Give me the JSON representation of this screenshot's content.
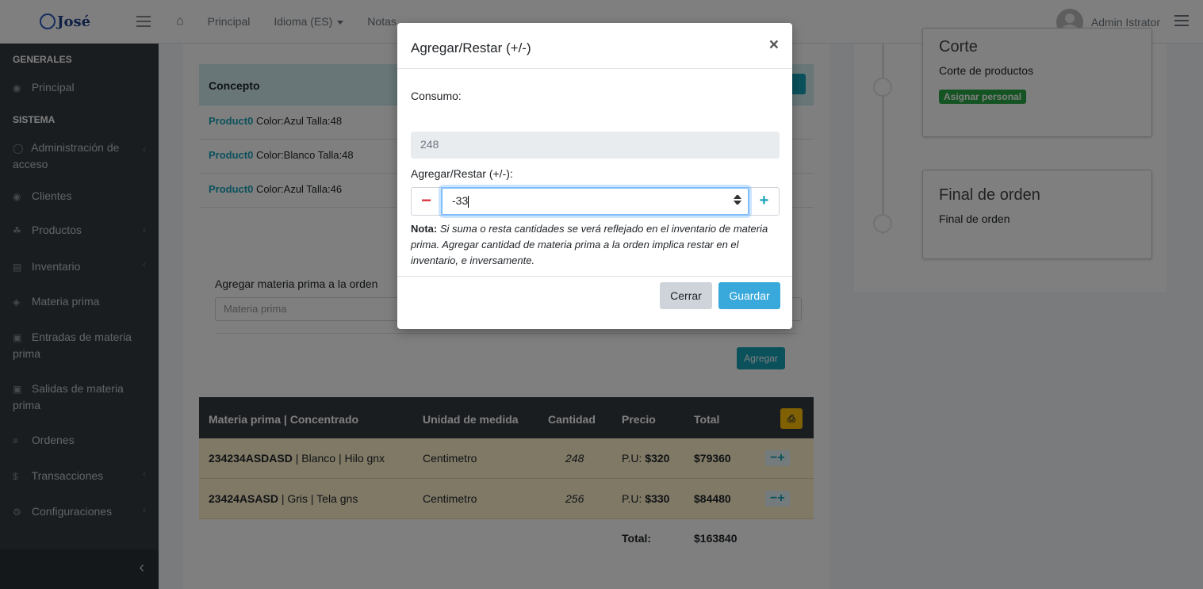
{
  "navbar": {
    "brand": "José",
    "links": [
      "Principal",
      "Idioma (ES)",
      "Notas"
    ],
    "user": "Admin Istrator"
  },
  "sidebar": {
    "headers": [
      "GENERALES",
      "SISTEMA"
    ],
    "items": [
      {
        "label": "Principal",
        "icon": "dashboard-icon"
      },
      {
        "label": "Administración de acceso",
        "icon": "user-icon"
      },
      {
        "label": "Clientes",
        "icon": "clients-icon"
      },
      {
        "label": "Productos",
        "icon": "products-icon"
      },
      {
        "label": "Inventario",
        "icon": "cart-icon"
      },
      {
        "label": "Materia prima",
        "icon": "box-icon"
      },
      {
        "label": "Entradas de materia prima",
        "icon": "plus-square-icon"
      },
      {
        "label": "Salidas de materia prima",
        "icon": "minus-square-icon"
      },
      {
        "label": "Ordenes",
        "icon": "list-icon"
      },
      {
        "label": "Transacciones",
        "icon": "dollar-icon"
      },
      {
        "label": "Configuraciones",
        "icon": "gears-icon"
      }
    ]
  },
  "content": {
    "concept_header": "Concepto",
    "products": [
      {
        "name": "Product0",
        "detail": "Color:Azul Talla:48"
      },
      {
        "name": "Product0",
        "detail": "Color:Blanco Talla:48"
      },
      {
        "name": "Product0",
        "detail": "Color:Azul Talla:46"
      }
    ],
    "add_label": "Agregar materia prima a la orden",
    "add_placeholder": "Materia prima",
    "add_button": "Agregar",
    "table": {
      "headers": [
        "Materia prima | Concentrado",
        "Unidad de medida",
        "Cantidad",
        "Precio",
        "Total"
      ],
      "rows": [
        {
          "code": "234234ASDASD",
          "rest": " | Blanco | Hilo gnx",
          "unit": "Centimetro",
          "qty": "248",
          "price_prefix": "P.U: ",
          "price": "$320",
          "total": "$79360"
        },
        {
          "code": "23424ASASD",
          "rest": " | Gris | Tela gns",
          "unit": "Centimetro",
          "qty": "256",
          "price_prefix": "P.U: ",
          "price": "$330",
          "total": "$84480"
        }
      ],
      "total_label": "Total:",
      "total_value": "$163840"
    }
  },
  "timeline": {
    "cards": [
      {
        "title": "Corte",
        "text": "Corte de productos",
        "badge": "Asignar personal"
      },
      {
        "title": "Final de orden",
        "text": "Final de orden"
      }
    ]
  },
  "modal": {
    "title": "Agregar/Restar (+/-)",
    "close": "×",
    "consumo_label": "Consumo:",
    "consumo_value": "248",
    "adjust_label": "Agregar/Restar (+/-):",
    "adjust_value": "-33",
    "note_bold": "Nota:",
    "note_text": " Si suma o resta cantidades se verá reflejado en el inventario de materia prima. Agregar cantidad de materia prima a la orden implica restar en el inventario, e inversamente.",
    "cancel": "Cerrar",
    "save": "Guardar"
  }
}
